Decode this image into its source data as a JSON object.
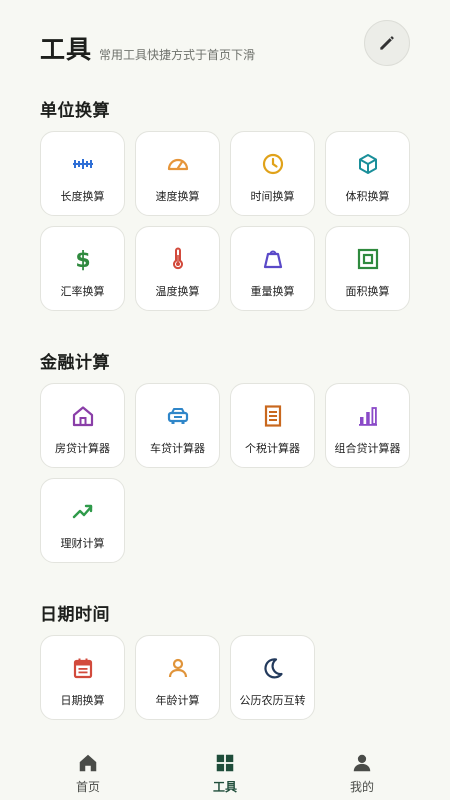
{
  "header": {
    "title": "工具",
    "subtitle": "常用工具快捷方式于首页下滑",
    "edit_icon": "pencil-icon"
  },
  "sections": [
    {
      "title": "单位换算",
      "items": [
        {
          "label": "长度换算",
          "icon": "ruler-icon",
          "color": "#2f6fd6"
        },
        {
          "label": "速度换算",
          "icon": "speedometer-icon",
          "color": "#e6953a"
        },
        {
          "label": "时间换算",
          "icon": "clock-icon",
          "color": "#e0a21a"
        },
        {
          "label": "体积换算",
          "icon": "cube-icon",
          "color": "#1a8f9a"
        },
        {
          "label": "汇率换算",
          "icon": "dollar-icon",
          "color": "#2f8a3e"
        },
        {
          "label": "温度换算",
          "icon": "thermometer-icon",
          "color": "#d24a3c"
        },
        {
          "label": "重量换算",
          "icon": "weight-icon",
          "color": "#5a49c8"
        },
        {
          "label": "面积换算",
          "icon": "area-square-icon",
          "color": "#2f8a3e"
        }
      ]
    },
    {
      "title": "金融计算",
      "items": [
        {
          "label": "房贷计算器",
          "icon": "house-icon",
          "color": "#8a3ea8"
        },
        {
          "label": "车贷计算器",
          "icon": "car-icon",
          "color": "#2f86c9"
        },
        {
          "label": "个税计算器",
          "icon": "receipt-icon",
          "color": "#c9681e"
        },
        {
          "label": "组合贷计算器",
          "icon": "bar-chart-icon",
          "color": "#8a4ac8"
        },
        {
          "label": "理财计算",
          "icon": "trending-up-icon",
          "color": "#2f9a4a"
        }
      ]
    },
    {
      "title": "日期时间",
      "items": [
        {
          "label": "日期换算",
          "icon": "calendar-icon",
          "color": "#d24a3c"
        },
        {
          "label": "年龄计算",
          "icon": "person-icon",
          "color": "#e0943a"
        },
        {
          "label": "公历农历互转",
          "icon": "moon-icon",
          "color": "#233a5c"
        }
      ]
    }
  ],
  "tabbar": [
    {
      "label": "首页",
      "icon": "home-icon",
      "active": false
    },
    {
      "label": "工具",
      "icon": "grid-icon",
      "active": true
    },
    {
      "label": "我的",
      "icon": "user-icon",
      "active": false
    }
  ],
  "colors": {
    "background": "#f7f8f3",
    "active_tab": "#1f4d3a",
    "inactive_tab": "#4a4c48"
  }
}
